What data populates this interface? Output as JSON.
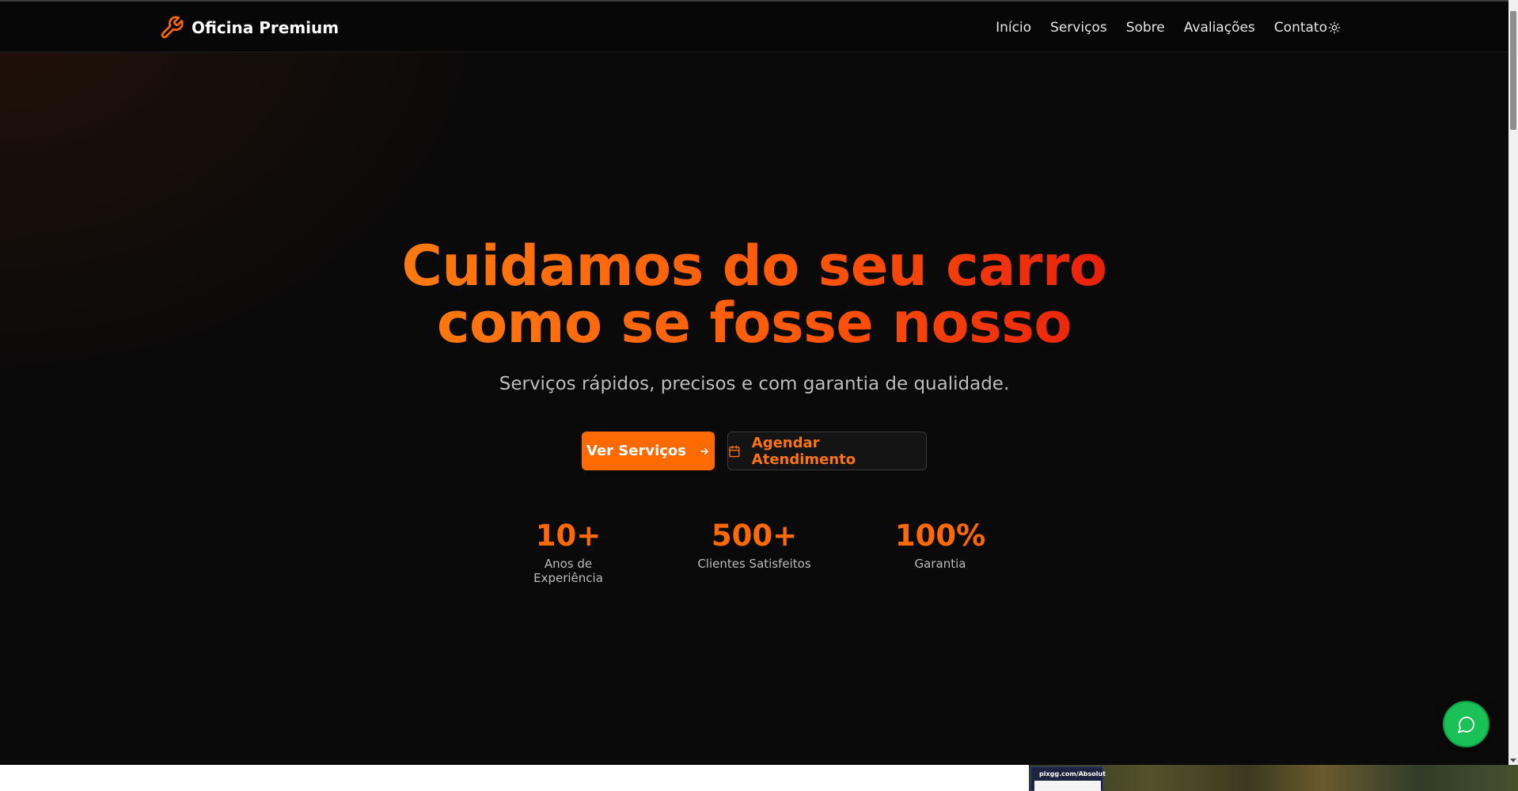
{
  "header": {
    "brand_name": "Oficina Premium",
    "brand_icon": "wrench-icon",
    "nav": [
      {
        "label": "Início"
      },
      {
        "label": "Serviços"
      },
      {
        "label": "Sobre"
      },
      {
        "label": "Avaliações"
      },
      {
        "label": "Contato"
      }
    ],
    "theme_toggle_icon": "sun-icon"
  },
  "hero": {
    "headline_line1": "Cuidamos do seu carro",
    "headline_line2": "como se fosse nosso",
    "subtitle": "Serviços rápidos, precisos e com garantia de qualidade.",
    "primary_button": {
      "label": "Ver Serviços",
      "icon": "arrow-right-icon"
    },
    "secondary_button": {
      "label": "Agendar Atendimento",
      "icon": "calendar-icon"
    }
  },
  "stats": [
    {
      "value": "10+",
      "label": "Anos de Experiência"
    },
    {
      "value": "500+",
      "label": "Clientes Satisfeitos"
    },
    {
      "value": "100%",
      "label": "Garantia"
    }
  ],
  "chat_button": {
    "icon": "chat-bubble-icon"
  },
  "ad": {
    "text": "pixgg.com/Absolut"
  },
  "colors": {
    "accent": "#ff6a00",
    "accent_red": "#e8200c",
    "background": "#0a0a0a",
    "whatsapp_green": "#19c157"
  }
}
